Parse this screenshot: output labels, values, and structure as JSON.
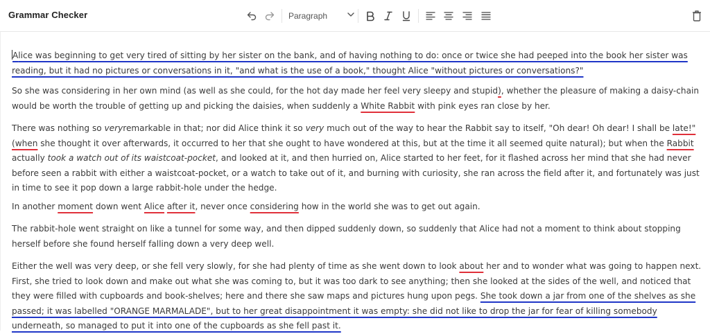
{
  "app": {
    "title": "Grammar Checker"
  },
  "toolbar": {
    "undo_icon": "undo-icon",
    "redo_icon": "redo-icon",
    "block_style": "Paragraph",
    "bold_icon": "bold-icon",
    "italic_icon": "italic-icon",
    "underline_icon": "underline-icon",
    "align_left_icon": "align-left-icon",
    "align_center_icon": "align-center-icon",
    "align_right_icon": "align-right-icon",
    "align_justify_icon": "align-justify-icon",
    "delete_icon": "trash-icon"
  },
  "colors": {
    "spelling_underline": "#e0303a",
    "grammar_underline": "#1f36c7"
  },
  "document": {
    "p1": {
      "cursor_char": "A",
      "flag_text": "lice was beginning to get very tired of sitting by her sister on the bank, and of having nothing to do: once or twice she had peeped into the book her sister was reading, but it had no pictures or conversations in it, \"and what is the use of a book,\" thought Alice \"without pictures or conversations?\""
    },
    "p2": {
      "a": "So she was considering in her own mind (as well as she could, for the hot day made her feel very sleepy and stupid",
      "flag1": ")",
      "b": ", whether the pleasure of making a daisy-chain would be worth the trouble of getting up and picking the daisies, when suddenly a ",
      "flag2": "White Rabbit",
      "c": " with pink eyes ran close by her."
    },
    "p3": {
      "a": "There was nothing so ",
      "em1": "very",
      "b": "remarkable in that; nor did Alice think it so ",
      "em2": "very",
      "c": " much out of the way to hear the Rabbit say to itself, \"Oh dear! Oh dear! I shall be ",
      "flag1": "late!\"",
      "d": " ",
      "flag2": "(when",
      "e": " she thought it over afterwards, it occurred to her that she ought to have wondered at this, but at the time it all seemed quite natural); but when the ",
      "flag3": "Rabbit",
      "f": " actually ",
      "em3": "took a watch out of its waistcoat-pocket",
      "g": ", and looked at it, and then hurried on, Alice started to her feet, for it flashed across her mind that she had never before seen a rabbit with either a waistcoat-pocket, or a watch to take out of it, and burning with curiosity, she ran across the field after it, and fortunately was just in time to see it pop down a large rabbit-hole under the hedge."
    },
    "p4": {
      "a": "In another ",
      "flag1": "moment",
      "b": " down went ",
      "flag2": "Alice",
      "c": " ",
      "flag3": "after it",
      "d": ", never once ",
      "flag4": "considering",
      "e": " how in the world she was to get out again."
    },
    "p5": {
      "text": "The rabbit-hole went straight on like a tunnel for some way, and then dipped suddenly down, so suddenly that Alice had not a moment to think about stopping herself before she found herself falling down a very deep well."
    },
    "p6": {
      "a": "Either the well was very deep, or she fell very slowly, for she had plenty of time as she went down to look ",
      "flag1": "about",
      "b": " her and to wonder what was going to happen next. First, she tried to look down and make out what she was coming to, but it was too dark to see anything; then she looked at the sides of the well, and noticed that they were filled with cupboards and book-shelves; here and there she saw maps and pictures hung upon pegs. ",
      "flag2": "She took down a jar from one of the shelves as she passed; it was labelled \"ORANGE MARMALADE\", but to her great disappointment it was empty: she did not like to drop the jar for fear of killing somebody underneath, so managed to put it into one of the cupboards as she fell past it."
    }
  }
}
